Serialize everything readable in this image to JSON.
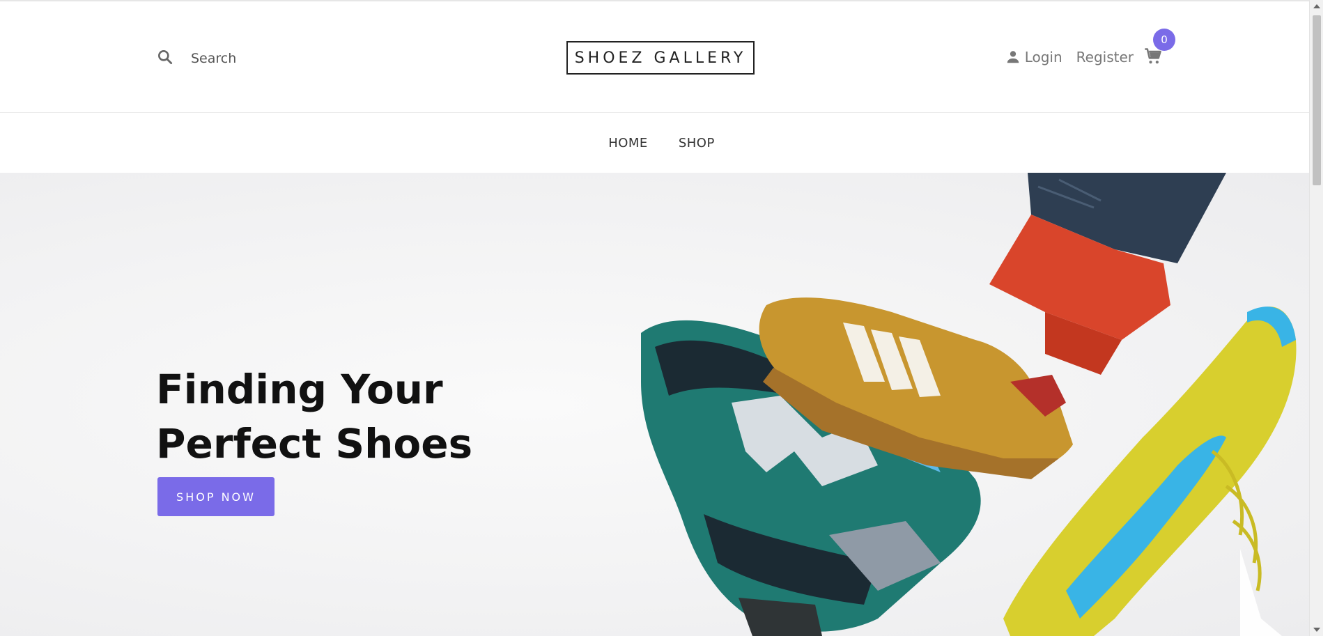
{
  "header": {
    "search": {
      "placeholder": "Search",
      "icon": "search-icon"
    },
    "logo": "SHOEZ GALLERY",
    "account": {
      "login_label": "Login",
      "register_label": "Register",
      "cart_count": "0"
    }
  },
  "nav": {
    "items": [
      {
        "label": "HOME"
      },
      {
        "label": "SHOP"
      }
    ]
  },
  "hero": {
    "title_line1": "Finding Your",
    "title_line2": "Perfect Shoes",
    "cta_label": "SHOP NOW"
  },
  "colors": {
    "accent": "#7a6be8",
    "text_dark": "#111111",
    "text_muted": "#777777"
  }
}
